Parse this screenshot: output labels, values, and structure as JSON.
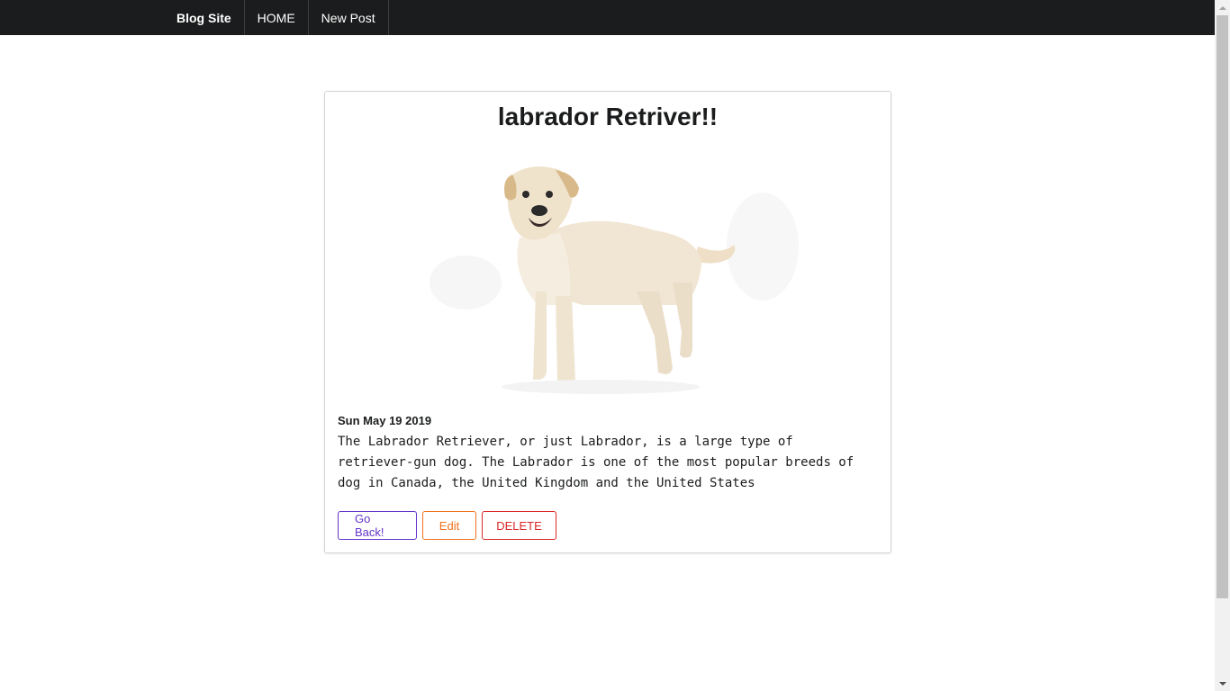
{
  "navbar": {
    "brand": "Blog Site",
    "items": [
      {
        "label": "HOME"
      },
      {
        "label": "New Post"
      }
    ]
  },
  "post": {
    "title": "labrador Retriver!!",
    "image_alt": "white labrador retriever dog",
    "date": "Sun May 19 2019",
    "body": "The Labrador Retriever, or just Labrador, is a large type of retriever-gun dog. The Labrador is one of the most popular breeds of dog in Canada, the United Kingdom and the United States"
  },
  "actions": {
    "back_label": "Go Back!",
    "edit_label": "Edit",
    "delete_label": "DELETE"
  },
  "colors": {
    "navbar_bg": "#1b1c1d",
    "back": "#6435c9",
    "edit": "#f2711c",
    "delete": "#db2828"
  }
}
